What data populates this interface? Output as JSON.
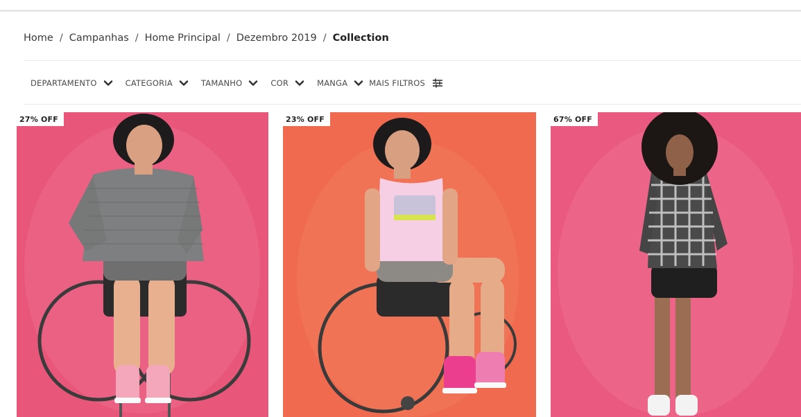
{
  "breadcrumb": {
    "items": [
      "Home",
      "Campanhas",
      "Home Principal",
      "Dezembro 2019"
    ],
    "current": "Collection",
    "separator": "/"
  },
  "filters": {
    "items": [
      {
        "label": "DEPARTAMENTO",
        "icon": "chevron-down-icon"
      },
      {
        "label": "CATEGORIA",
        "icon": "chevron-down-icon"
      },
      {
        "label": "TAMANHO",
        "icon": "chevron-down-icon"
      },
      {
        "label": "COR",
        "icon": "chevron-down-icon"
      },
      {
        "label": "MANGA",
        "icon": "chevron-down-icon"
      }
    ],
    "more_label": "MAIS FILTROS",
    "more_icon": "sliders-icon"
  },
  "products": [
    {
      "badge": "27% OFF",
      "background_color": "#e8567a"
    },
    {
      "badge": "23% OFF",
      "background_color": "#ef6a4e"
    },
    {
      "badge": "67% OFF",
      "background_color": "#ea5a80"
    }
  ]
}
